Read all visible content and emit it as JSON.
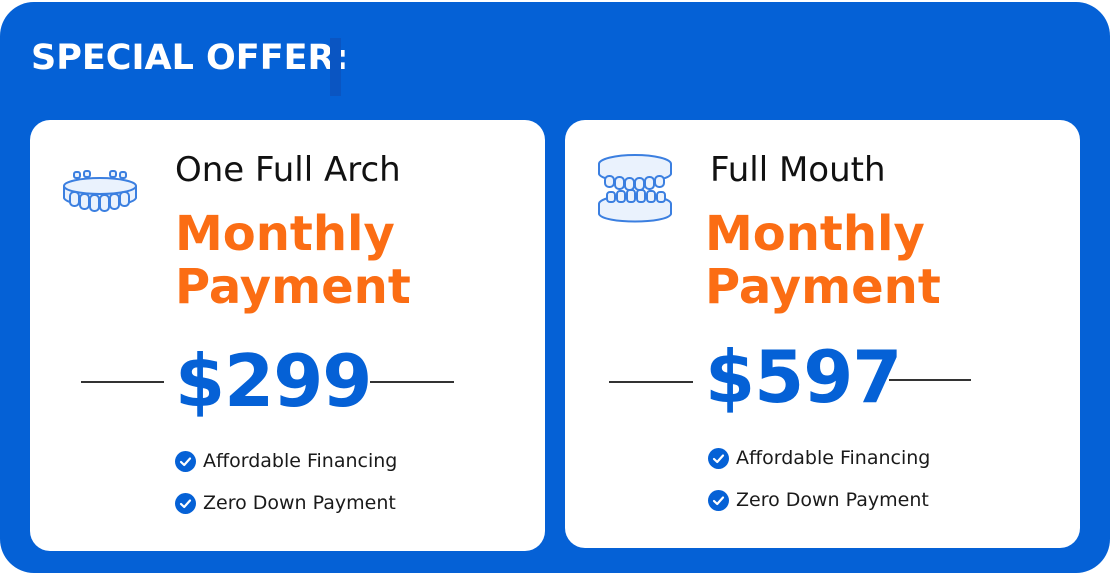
{
  "banner": {
    "headline": "SPECIAL OFFER:",
    "colors": {
      "background": "#0561d6",
      "accent": "#fb6d14",
      "text": "#ffffff"
    }
  },
  "plans": [
    {
      "icon": "single-arch-teeth-icon",
      "name": "One Full Arch",
      "payment_line1": "Monthly",
      "payment_line2": "Payment",
      "price": "$299",
      "features": [
        "Affordable Financing",
        "Zero Down Payment"
      ]
    },
    {
      "icon": "full-mouth-teeth-icon",
      "name": "Full Mouth",
      "payment_line1": "Monthly",
      "payment_line2": "Payment",
      "price": "$597",
      "features": [
        "Affordable Financing",
        "Zero Down Payment"
      ]
    }
  ]
}
